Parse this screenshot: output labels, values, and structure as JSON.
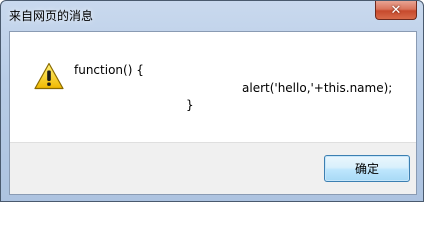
{
  "dialog": {
    "title": "来自网页的消息",
    "close_glyph": "✕",
    "message_lines": [
      "function() {",
      "alert('hello,'+this.name);",
      "}"
    ],
    "icon": "warning-icon",
    "ok_label": "确定"
  },
  "colors": {
    "accent_title_gradient": "#b8cce6",
    "close_button_red": "#c74a2d",
    "warning_yellow": "#f5c400",
    "ok_button_border": "#3c7fb1",
    "footer_background": "#f0f0f0"
  }
}
